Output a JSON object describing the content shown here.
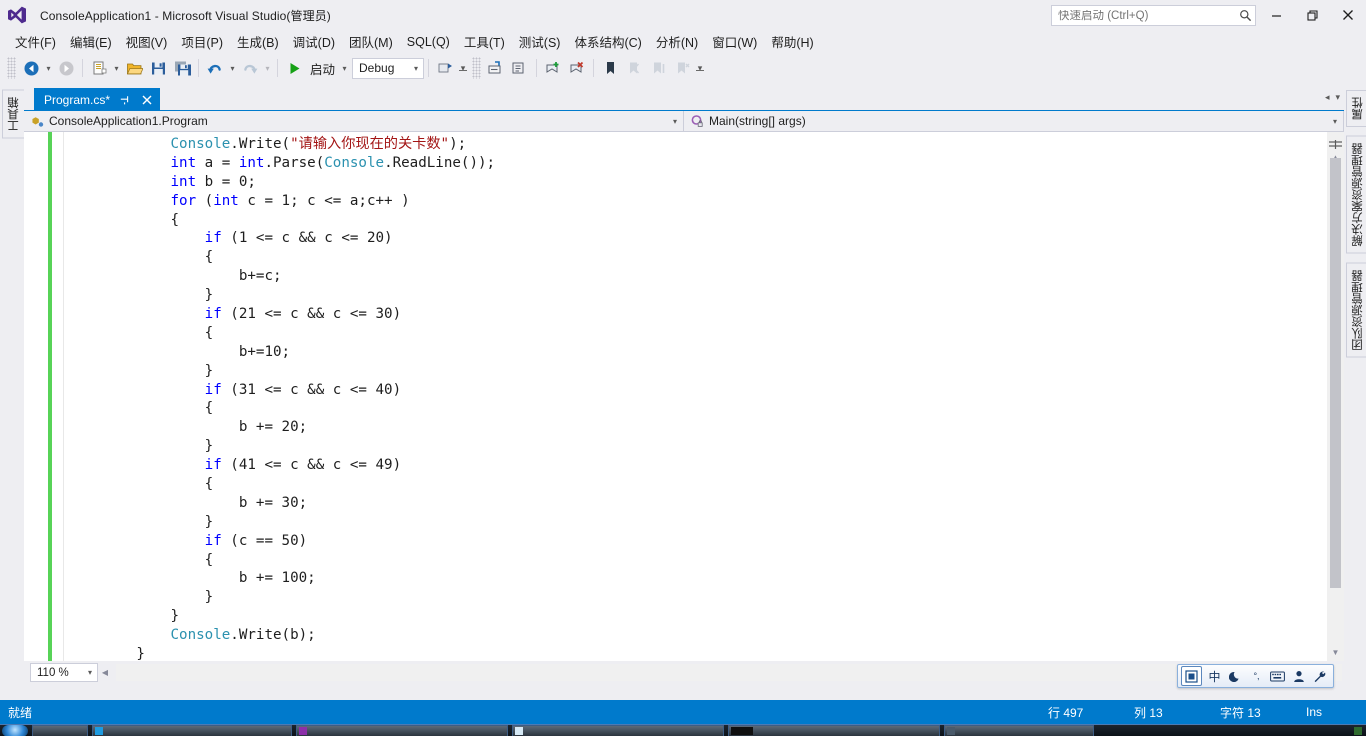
{
  "window": {
    "title": "ConsoleApplication1 - Microsoft Visual Studio(管理员)",
    "logo_icon": "visual-studio-logo-icon",
    "minimize_icon": "minimize-icon",
    "maximize_icon": "restore-icon",
    "close_icon": "close-icon"
  },
  "quick_launch": {
    "placeholder": "快速启动 (Ctrl+Q)",
    "value": "",
    "icon": "search-icon"
  },
  "menu": {
    "items": [
      {
        "label": "文件(F)",
        "key": "F"
      },
      {
        "label": "编辑(E)",
        "key": "E"
      },
      {
        "label": "视图(V)",
        "key": "V"
      },
      {
        "label": "项目(P)",
        "key": "P"
      },
      {
        "label": "生成(B)",
        "key": "B"
      },
      {
        "label": "调试(D)",
        "key": "D"
      },
      {
        "label": "团队(M)",
        "key": "M"
      },
      {
        "label": "SQL(Q)",
        "key": "Q"
      },
      {
        "label": "工具(T)",
        "key": "T"
      },
      {
        "label": "测试(S)",
        "key": "S"
      },
      {
        "label": "体系结构(C)",
        "key": "C"
      },
      {
        "label": "分析(N)",
        "key": "N"
      },
      {
        "label": "窗口(W)",
        "key": "W"
      },
      {
        "label": "帮助(H)",
        "key": "H"
      }
    ]
  },
  "toolbar": {
    "navigate_back_icon": "navigate-back-icon",
    "navigate_forward_icon": "navigate-forward-icon",
    "new_project_icon": "new-project-icon",
    "open_file_icon": "open-file-icon",
    "save_icon": "save-icon",
    "save_all_icon": "save-all-icon",
    "undo_icon": "undo-icon",
    "redo_icon": "redo-icon",
    "start_icon": "start-debug-play-icon",
    "start_label": "启动",
    "configuration_value": "Debug",
    "attach_icon": "attach-to-process-icon",
    "comment_icon": "comment-selection-icon",
    "uncomment_icon": "uncomment-selection-icon",
    "toggle_bookmark_icon": "toggle-bookmark-icon",
    "prev_bookmark_icon": "previous-bookmark-icon",
    "next_bookmark_icon": "next-bookmark-icon",
    "clear_bookmarks_icon": "clear-bookmarks-icon",
    "overflow_icon": "toolbar-overflow-icon"
  },
  "left_dock": {
    "tabs": [
      {
        "label": "工具箱",
        "icon": "toolbox-icon"
      }
    ]
  },
  "right_dock": {
    "tabs": [
      {
        "label": "属性"
      },
      {
        "label": "解决方案资源管理器"
      },
      {
        "label": "团队资源管理器"
      }
    ]
  },
  "editor": {
    "tab": {
      "label": "Program.cs*",
      "pin_icon": "pin-icon",
      "close_icon": "close-icon"
    },
    "tab_nav_icons": [
      "chevron-left-icon",
      "chevron-down-icon"
    ],
    "navbar": {
      "type_icon": "class-icon",
      "type_value": "ConsoleApplication1.Program",
      "member_icon": "method-private-icon",
      "member_value": "Main(string[] args)",
      "dropdown_icon": "chevron-down-icon"
    },
    "zoom": {
      "value": "110 %",
      "dropdown_icon": "chevron-down-icon"
    },
    "scrollbar": {
      "up_icon": "scroll-up-icon",
      "down_icon": "scroll-down-icon",
      "split_icon": "split-view-icon"
    },
    "code": [
      {
        "indent": 12,
        "tokens": [
          {
            "t": "Console",
            "c": "typ"
          },
          {
            "t": ".Write(",
            "c": "pln"
          },
          {
            "t": "\"请输入你现在的关卡数\"",
            "c": "str"
          },
          {
            "t": ");",
            "c": "pln"
          }
        ]
      },
      {
        "indent": 12,
        "tokens": [
          {
            "t": "int",
            "c": "kw"
          },
          {
            "t": " a = ",
            "c": "pln"
          },
          {
            "t": "int",
            "c": "kw"
          },
          {
            "t": ".Parse(",
            "c": "pln"
          },
          {
            "t": "Console",
            "c": "typ"
          },
          {
            "t": ".ReadLine());",
            "c": "pln"
          }
        ]
      },
      {
        "indent": 12,
        "tokens": [
          {
            "t": "int",
            "c": "kw"
          },
          {
            "t": " b = 0;",
            "c": "pln"
          }
        ]
      },
      {
        "indent": 12,
        "tokens": [
          {
            "t": "for",
            "c": "kw"
          },
          {
            "t": " (",
            "c": "pln"
          },
          {
            "t": "int",
            "c": "kw"
          },
          {
            "t": " c = 1; c <= a;c++ )",
            "c": "pln"
          }
        ]
      },
      {
        "indent": 12,
        "tokens": [
          {
            "t": "{",
            "c": "pln"
          }
        ]
      },
      {
        "indent": 16,
        "tokens": [
          {
            "t": "if",
            "c": "kw"
          },
          {
            "t": " (1 <= c && c <= 20)",
            "c": "pln"
          }
        ]
      },
      {
        "indent": 16,
        "tokens": [
          {
            "t": "{",
            "c": "pln"
          }
        ]
      },
      {
        "indent": 20,
        "tokens": [
          {
            "t": "b+=c;",
            "c": "pln"
          }
        ]
      },
      {
        "indent": 16,
        "tokens": [
          {
            "t": "}",
            "c": "pln"
          }
        ]
      },
      {
        "indent": 16,
        "tokens": [
          {
            "t": "if",
            "c": "kw"
          },
          {
            "t": " (21 <= c && c <= 30)",
            "c": "pln"
          }
        ]
      },
      {
        "indent": 16,
        "tokens": [
          {
            "t": "{",
            "c": "pln"
          }
        ]
      },
      {
        "indent": 20,
        "tokens": [
          {
            "t": "b+=10;",
            "c": "pln"
          }
        ]
      },
      {
        "indent": 16,
        "tokens": [
          {
            "t": "}",
            "c": "pln"
          }
        ]
      },
      {
        "indent": 16,
        "tokens": [
          {
            "t": "if",
            "c": "kw"
          },
          {
            "t": " (31 <= c && c <= 40)",
            "c": "pln"
          }
        ]
      },
      {
        "indent": 16,
        "tokens": [
          {
            "t": "{",
            "c": "pln"
          }
        ]
      },
      {
        "indent": 20,
        "tokens": [
          {
            "t": "b += 20;",
            "c": "pln"
          }
        ]
      },
      {
        "indent": 16,
        "tokens": [
          {
            "t": "}",
            "c": "pln"
          }
        ]
      },
      {
        "indent": 16,
        "tokens": [
          {
            "t": "if",
            "c": "kw"
          },
          {
            "t": " (41 <= c && c <= 49)",
            "c": "pln"
          }
        ]
      },
      {
        "indent": 16,
        "tokens": [
          {
            "t": "{",
            "c": "pln"
          }
        ]
      },
      {
        "indent": 20,
        "tokens": [
          {
            "t": "b += 30;",
            "c": "pln"
          }
        ]
      },
      {
        "indent": 16,
        "tokens": [
          {
            "t": "}",
            "c": "pln"
          }
        ]
      },
      {
        "indent": 16,
        "tokens": [
          {
            "t": "if",
            "c": "kw"
          },
          {
            "t": " (c == 50)",
            "c": "pln"
          }
        ]
      },
      {
        "indent": 16,
        "tokens": [
          {
            "t": "{",
            "c": "pln"
          }
        ]
      },
      {
        "indent": 20,
        "tokens": [
          {
            "t": "b += 100;",
            "c": "pln"
          }
        ]
      },
      {
        "indent": 16,
        "tokens": [
          {
            "t": "}",
            "c": "pln"
          }
        ]
      },
      {
        "indent": 12,
        "tokens": [
          {
            "t": "}",
            "c": "pln"
          }
        ]
      },
      {
        "indent": 12,
        "tokens": [
          {
            "t": "Console",
            "c": "typ"
          },
          {
            "t": ".Write(b);",
            "c": "pln"
          }
        ]
      },
      {
        "indent": 8,
        "tokens": [
          {
            "t": "}",
            "c": "pln"
          }
        ]
      },
      {
        "indent": 4,
        "tokens": [
          {
            "t": "}",
            "c": "pln"
          }
        ]
      }
    ]
  },
  "ime": {
    "items": [
      {
        "icon": "ime-logo-icon",
        "label": "囝"
      },
      {
        "icon": "chinese-mode-icon",
        "label": "中"
      },
      {
        "icon": "moon-punctuation-icon",
        "label": "☾"
      },
      {
        "icon": "halfwidth-punctuation-icon",
        "label": "°,"
      },
      {
        "icon": "soft-keyboard-icon",
        "label": "⌨"
      },
      {
        "icon": "user-icon",
        "label": "♟"
      },
      {
        "icon": "wrench-settings-icon",
        "label": "🔧"
      }
    ]
  },
  "statusbar": {
    "status": "就绪",
    "line_label": "行 497",
    "column_label": "列 13",
    "char_label": "字符 13",
    "insert_mode": "Ins"
  },
  "taskbar": {
    "start_icon": "windows-start-orb-icon",
    "items": [
      {
        "name": "taskbar-item-1",
        "color": "#1e9be0"
      },
      {
        "name": "taskbar-item-2",
        "color": "#8b2fa8"
      },
      {
        "name": "taskbar-item-3",
        "color": "#d6e9f5"
      },
      {
        "name": "taskbar-item-4",
        "color": "#101010"
      },
      {
        "name": "taskbar-item-5",
        "color": "#4a5a6a"
      },
      {
        "name": "taskbar-item-6",
        "color": "#2f6b2f"
      }
    ]
  },
  "colors": {
    "accent": "#007acc",
    "chrome": "#eeeef2",
    "keyword": "#0000ff",
    "type": "#2b91af",
    "string": "#a31515",
    "change_bar": "#57d357"
  }
}
